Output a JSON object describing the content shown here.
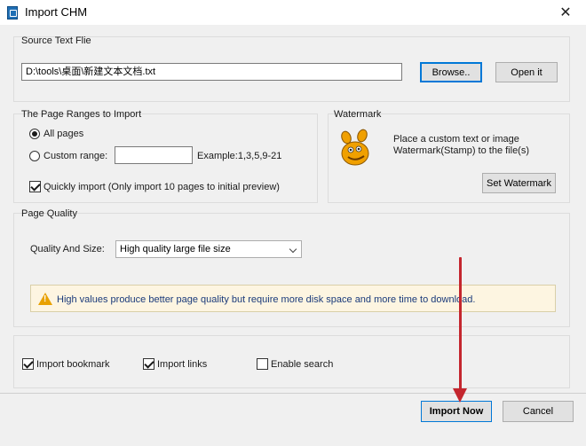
{
  "window": {
    "title": "Import CHM",
    "close_glyph": "✕"
  },
  "source": {
    "title": "Source Text Flie",
    "path_value": "D:\\tools\\桌面\\新建文本文档.txt",
    "browse_label": "Browse..",
    "open_label": "Open it"
  },
  "ranges": {
    "title": "The Page Ranges to Import",
    "all_pages_label": "All pages",
    "custom_range_label": "Custom range:",
    "custom_range_value": "",
    "example_label": "Example:1,3,5,9-21",
    "quick_import_label": "Quickly import (Only import 10 pages to  initial  preview)"
  },
  "watermark": {
    "title": "Watermark",
    "desc_line1": "Place a custom text or image",
    "desc_line2": "Watermark(Stamp) to the file(s)",
    "set_label": "Set Watermark",
    "icon": "gimp-icon"
  },
  "quality": {
    "title": "Page Quality",
    "size_label": "Quality And Size:",
    "selected": "High quality large file size",
    "warning": "High values produce better page quality but require more disk space and more time to download."
  },
  "options": {
    "bookmark_label": "Import bookmark",
    "links_label": "Import links",
    "search_label": "Enable search"
  },
  "footer": {
    "import_label": "Import Now",
    "cancel_label": "Cancel"
  },
  "colors": {
    "accent": "#0078d7",
    "arrow": "#c4262e",
    "warning_bg": "#fdf5e1"
  }
}
